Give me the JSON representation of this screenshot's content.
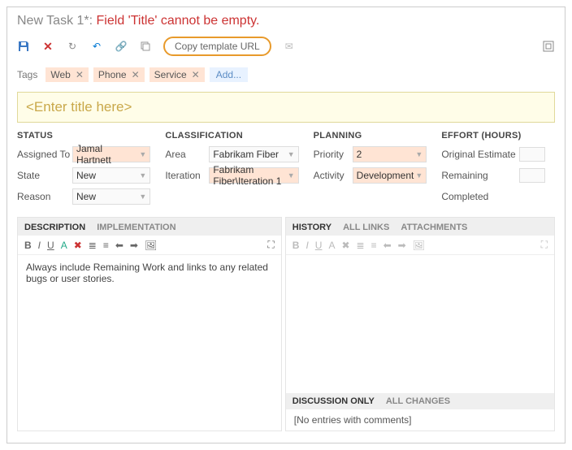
{
  "header": {
    "title": "New Task 1*",
    "error": "Field 'Title' cannot be empty."
  },
  "toolbar": {
    "copy_template": "Copy template URL"
  },
  "tags": {
    "label": "Tags",
    "items": [
      "Web",
      "Phone",
      "Service"
    ],
    "add": "Add..."
  },
  "title_placeholder": "<Enter title here>",
  "status": {
    "heading": "STATUS",
    "assigned_label": "Assigned To",
    "assigned_value": "Jamal Hartnett",
    "state_label": "State",
    "state_value": "New",
    "reason_label": "Reason",
    "reason_value": "New"
  },
  "classification": {
    "heading": "CLASSIFICATION",
    "area_label": "Area",
    "area_value": "Fabrikam Fiber",
    "iter_label": "Iteration",
    "iter_value": "Fabrikam Fiber\\Iteration 1"
  },
  "planning": {
    "heading": "PLANNING",
    "priority_label": "Priority",
    "priority_value": "2",
    "activity_label": "Activity",
    "activity_value": "Development"
  },
  "effort": {
    "heading": "EFFORT (HOURS)",
    "orig_label": "Original Estimate",
    "rem_label": "Remaining",
    "comp_label": "Completed"
  },
  "left_tabs": {
    "desc": "DESCRIPTION",
    "impl": "IMPLEMENTATION"
  },
  "right_tabs": {
    "hist": "HISTORY",
    "links": "ALL LINKS",
    "att": "ATTACHMENTS"
  },
  "description_text": "Always include Remaining Work and links to any related bugs or user stories.",
  "discussion": {
    "only": "DISCUSSION ONLY",
    "all": "ALL CHANGES",
    "empty": "[No entries with comments]"
  }
}
